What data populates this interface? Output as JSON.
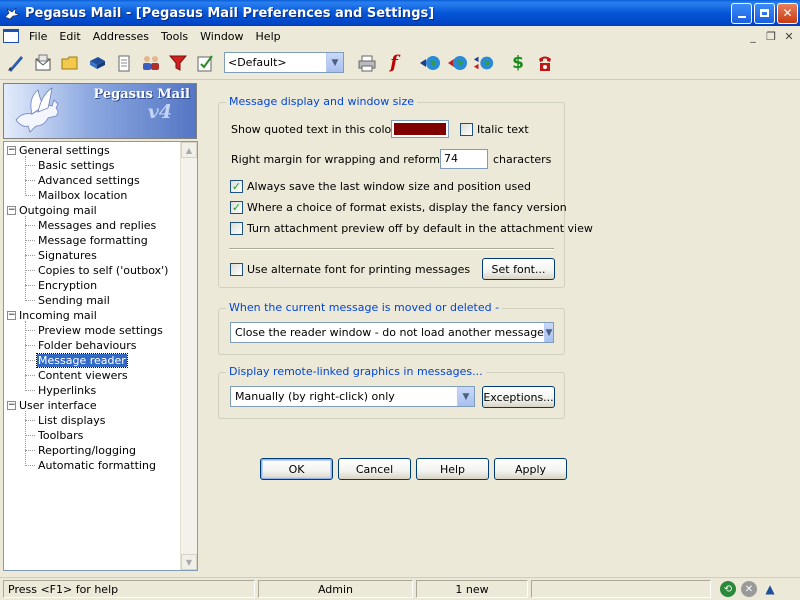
{
  "window": {
    "title": "Pegasus Mail - [Pegasus Mail Preferences and Settings]",
    "minimize_icon": "minimize-icon",
    "restore_icon": "restore-icon",
    "close_icon": "close-icon"
  },
  "menu": {
    "items": [
      "File",
      "Edit",
      "Addresses",
      "Tools",
      "Window",
      "Help"
    ]
  },
  "toolbar": {
    "identity": "<Default>",
    "icons": [
      "new-message-icon",
      "read-mail-icon",
      "folders-icon",
      "addressbooks-icon",
      "notepad-icon",
      "distribution-lists-icon",
      "filters-icon",
      "checklist-icon"
    ],
    "right_icons": [
      "print-icon",
      "font-icon",
      "send-globe-icon",
      "receive-globe-icon",
      "send-receive-globe-icon",
      "dollar-icon",
      "dialup-icon"
    ]
  },
  "logo": {
    "brand": "Pegasus Mail",
    "version": "v4"
  },
  "tree": {
    "groups": [
      {
        "label": "General settings",
        "children": [
          "Basic settings",
          "Advanced settings",
          "Mailbox location"
        ]
      },
      {
        "label": "Outgoing mail",
        "children": [
          "Messages and replies",
          "Message formatting",
          "Signatures",
          "Copies to self ('outbox')",
          "Encryption",
          "Sending mail"
        ]
      },
      {
        "label": "Incoming mail",
        "children": [
          "Preview mode settings",
          "Folder behaviours",
          "Message reader",
          "Content viewers",
          "Hyperlinks"
        ]
      },
      {
        "label": "User interface",
        "children": [
          "List displays",
          "Toolbars",
          "Reporting/logging",
          "Automatic formatting"
        ]
      }
    ],
    "selected": "Message reader"
  },
  "display_group": {
    "title": "Message display and window size",
    "quoted_colour_label": "Show quoted text in this colour -",
    "quoted_colour": "#800000",
    "italic_label": "Italic text",
    "italic_checked": false,
    "margin_label": "Right margin for wrapping and reformatting:",
    "margin_value": "74",
    "margin_units": "characters",
    "save_size_label": "Always save the last window size and position used",
    "save_size_checked": true,
    "fancy_label": "Where a choice of format exists, display the fancy version",
    "fancy_checked": true,
    "attach_preview_label": "Turn attachment preview off by default in the attachment view",
    "attach_preview_checked": false,
    "alt_font_label": "Use alternate font for printing messages",
    "alt_font_checked": false,
    "set_font_button": "Set font..."
  },
  "moved_group": {
    "title": "When the current message is moved or deleted -",
    "selected": "Close the reader window - do not load another message"
  },
  "graphics_group": {
    "title": "Display remote-linked graphics in messages...",
    "selected": "Manually (by right-click) only",
    "exceptions_button": "Exceptions..."
  },
  "buttons": {
    "ok": "OK",
    "cancel": "Cancel",
    "help": "Help",
    "apply": "Apply"
  },
  "statusbar": {
    "help_text": "Press <F1> for help",
    "user": "Admin",
    "new_count": "1 new"
  }
}
